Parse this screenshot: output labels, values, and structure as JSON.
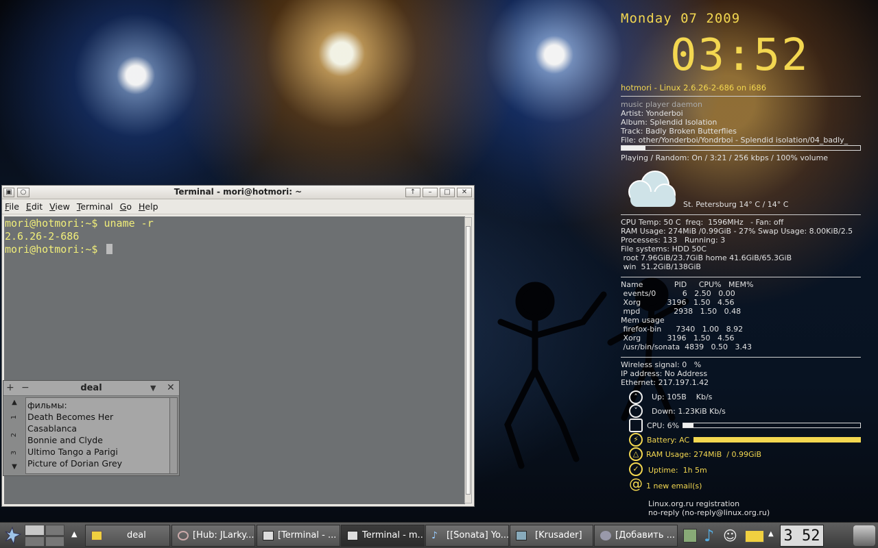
{
  "terminal": {
    "title": "Terminal - mori@hotmori: ~",
    "menu": [
      "File",
      "Edit",
      "View",
      "Terminal",
      "Go",
      "Help"
    ],
    "lines": [
      "mori@hotmori:~$ uname -r",
      "2.6.26-2-686",
      "mori@hotmori:~$ "
    ]
  },
  "deal": {
    "title": "deal",
    "tabs": [
      "1",
      "2",
      "3"
    ],
    "items": [
      "фильмы:",
      "Death Becomes Her",
      "Casablanca",
      "Bonnie and Clyde",
      "Ultimo Tango a Parigi",
      "Picture of Dorian Grey"
    ]
  },
  "conky": {
    "date": "Monday 07 2009",
    "time": "03:52",
    "host": "hotmori - Linux 2.6.26-2-686 on i686",
    "mpd": {
      "header": "music player daemon",
      "artist": "Artist: Yonderboi",
      "album": "Album: Splendid Isolation",
      "track": "Track: Badly Broken Butterflies",
      "file": "File: other/Yonderboi/Yondrboi - Splendid isolation/04_badly_",
      "progress": 0.1,
      "status": "Playing / Random: On / 3:21 / 256 kbps / 100% volume"
    },
    "weather": "St. Petersburg 14° C / 14° C",
    "sys": [
      "CPU Temp: 50 C  freq:  1596MHz   - Fan: off",
      "RAM Usage: 274MiB /0.99GiB - 27% Swap Usage: 8.00KiB/2.5",
      "Processes: 133   Running: 3",
      "File systems: HDD 50C",
      " root 7.96GiB/23.7GiB home 41.6GiB/65.3GiB",
      " win  51.2GiB/138GiB"
    ],
    "procs": [
      "Name             PID     CPU%   MEM%",
      " events/0           6   2.50   0.00",
      " Xorg           3196   1.50   4.56",
      " mpd              2938   1.50   0.48",
      "Mem usage",
      " firefox-bin      7340   1.00   8.92",
      " Xorg           3196   1.50   4.56",
      " /usr/bin/sonata  4839   0.50   3.43"
    ],
    "net": [
      "Wireless signal: 0   %",
      "IP address: No Address",
      "Ethernet: 217.197.1.42"
    ],
    "up": "Up: 105B    Kb/s",
    "down": "Down: 1.23KiB Kb/s",
    "cpu": "CPU: 6%",
    "cpu_level": 0.06,
    "battery": "Battery: AC",
    "battery_level": 1.0,
    "ram": "RAM Usage: 274MiB  / 0.99GiB",
    "uptime": "Uptime:  1h 5m",
    "email": "1 new email(s)",
    "mail_subject": "Linux.org.ru registration",
    "mail_from": "no-reply (no-reply@linux.org.ru)"
  },
  "taskbar": {
    "tasks": [
      "deal",
      "[Hub: JLarky....",
      "[Terminal - ...",
      "Terminal - m...",
      "[[Sonata] Yo...",
      "[Krusader]",
      "[Добавить ..."
    ],
    "clock": "3 52"
  },
  "colors": {
    "accent": "#f3d750",
    "terminal_text": "#f2ef7a"
  }
}
